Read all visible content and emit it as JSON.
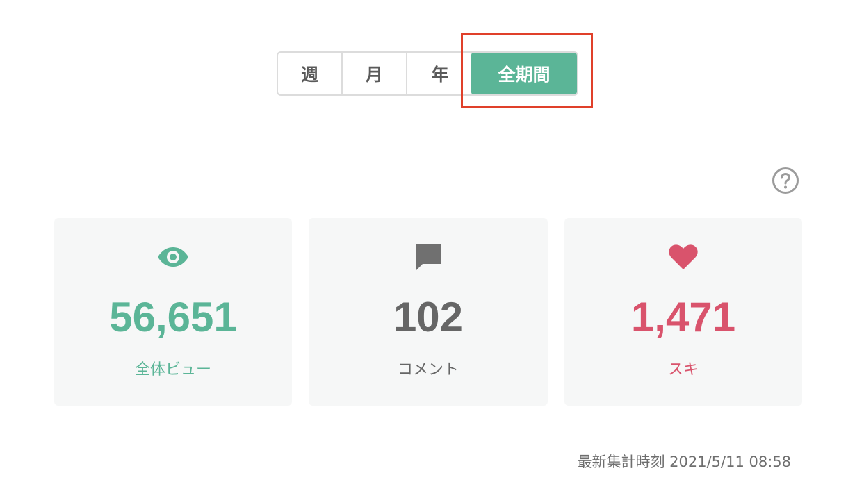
{
  "period_tabs": [
    {
      "label": "週",
      "active": false
    },
    {
      "label": "月",
      "active": false
    },
    {
      "label": "年",
      "active": false
    },
    {
      "label": "全期間",
      "active": true
    }
  ],
  "help_icon": "question-circle-icon",
  "stats": {
    "views": {
      "icon": "eye-icon",
      "value": "56,651",
      "label": "全体ビュー",
      "color": "#5bb597"
    },
    "comments": {
      "icon": "comment-icon",
      "value": "102",
      "label": "コメント",
      "color": "#666666"
    },
    "likes": {
      "icon": "heart-icon",
      "value": "1,471",
      "label": "スキ",
      "color": "#d9536c"
    }
  },
  "updated_at": "最新集計時刻 2021/5/11 08:58",
  "colors": {
    "accent": "#5bb597",
    "highlight": "#e0402a",
    "like": "#d9536c"
  }
}
